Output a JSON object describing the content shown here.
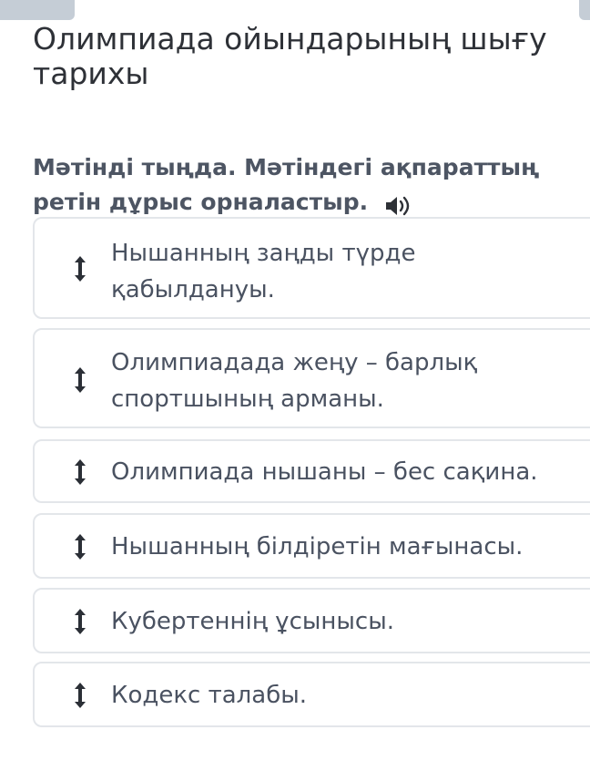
{
  "page": {
    "title": "Олимпиада ойындарының шығу тарихы",
    "instruction": "Мәтінді тыңда. Мәтіндегі ақпараттың ретін дұрыс орналастыр."
  },
  "icons": {
    "speaker": "speaker-icon",
    "drag": "drag-handle-icon"
  },
  "colors": {
    "text_primary": "#2e3137",
    "text_secondary": "#4a5261",
    "border": "#e3e6ea",
    "tab": "#c5cdd6"
  },
  "items": [
    {
      "label": "Нышанның заңды түрде қабылдануы."
    },
    {
      "label": "Олимпиадада жеңу – барлық спортшының арманы."
    },
    {
      "label": "Олимпиада нышаны – бес сақина."
    },
    {
      "label": "Нышанның білдіретін мағынасы."
    },
    {
      "label": "Кубертеннің ұсынысы."
    },
    {
      "label": "Кодекс талабы."
    }
  ]
}
